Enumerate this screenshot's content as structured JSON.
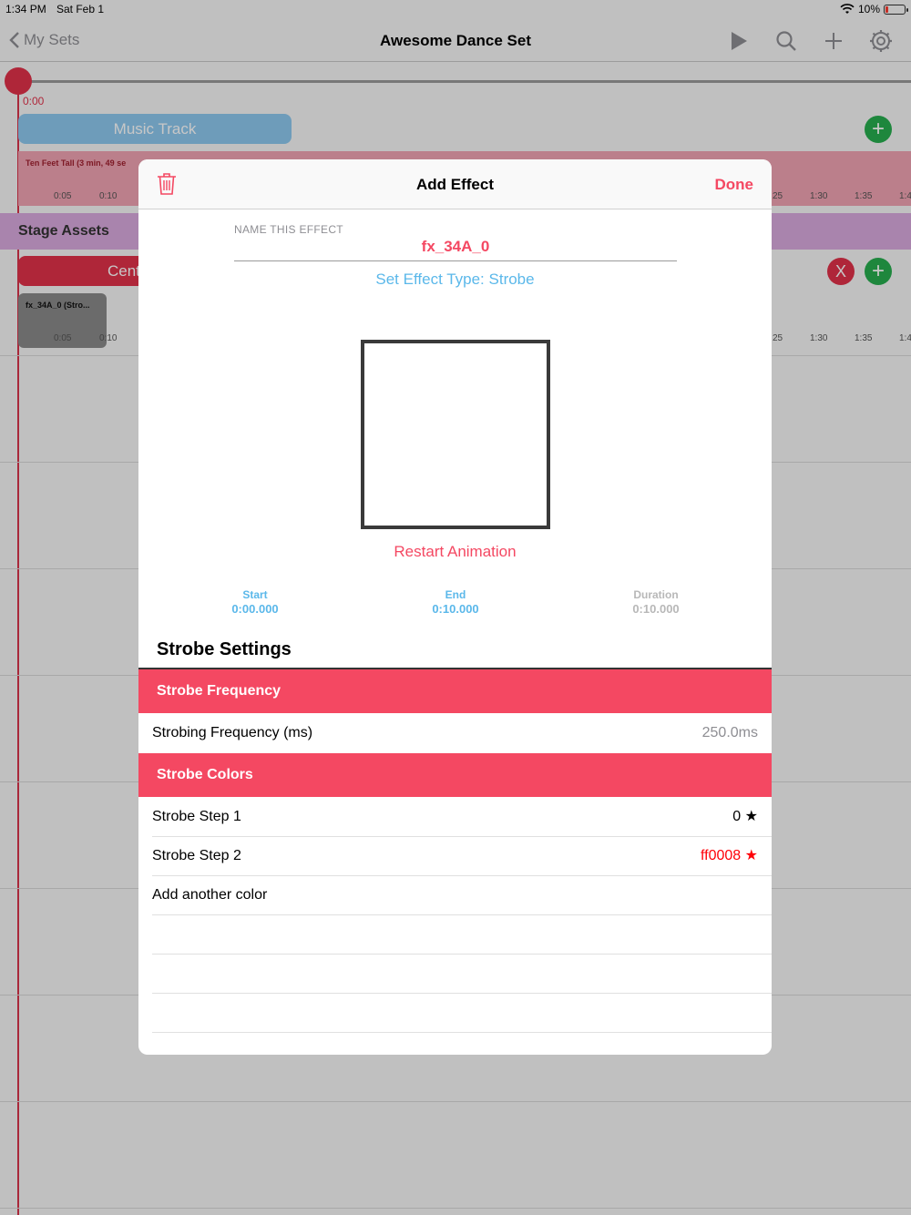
{
  "status_bar": {
    "time": "1:34 PM",
    "date": "Sat Feb 1",
    "battery": "10%",
    "battery_level": 0.1
  },
  "nav": {
    "back_label": "My Sets",
    "title": "Awesome Dance Set",
    "icons": [
      "play-icon",
      "search-icon",
      "plus-icon",
      "gear-icon"
    ]
  },
  "timeline": {
    "time_zero": "0:00",
    "music_track_label": "Music Track",
    "song_label": "Ten Feet Tall (3 min, 49 se",
    "ticks_left": [
      "0:05",
      "0:10"
    ],
    "ticks_right": [
      "25",
      "1:30",
      "1:35",
      "1:4"
    ],
    "stage_assets_label": "Stage Assets",
    "center_label": "Cent",
    "fx_block_label": "fx_34A_0 (Stro...",
    "remove_button_label": "X"
  },
  "modal": {
    "title": "Add Effect",
    "done_label": "Done",
    "name_caption": "NAME THIS EFFECT",
    "name_value": "fx_34A_0",
    "effect_type": "Set Effect Type: Strobe",
    "restart_label": "Restart Animation",
    "start": {
      "label": "Start",
      "value": "0:00.000"
    },
    "end": {
      "label": "End",
      "value": "0:10.000"
    },
    "duration": {
      "label": "Duration",
      "value": "0:10.000"
    },
    "section_title": "Strobe Settings",
    "frequency_header": "Strobe Frequency",
    "frequency_label": "Strobing Frequency (ms)",
    "frequency_value": "250.0ms",
    "colors_header": "Strobe Colors",
    "steps": [
      {
        "label": "Strobe Step 1",
        "value": "0",
        "color": "#000000"
      },
      {
        "label": "Strobe Step 2",
        "value": "ff0008",
        "color": "#ff0008"
      }
    ],
    "add_color_label": "Add another color"
  },
  "colors": {
    "accent": "#f44862",
    "link_blue": "#5bb8ea",
    "playhead": "#e0314a",
    "add_green": "#27ae4f"
  }
}
